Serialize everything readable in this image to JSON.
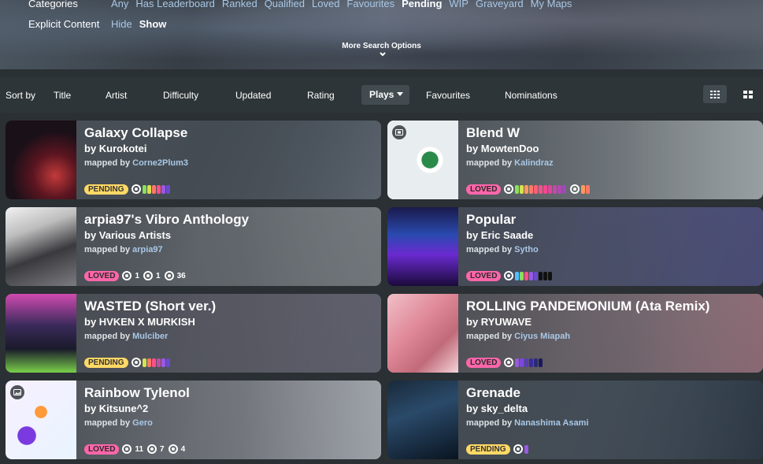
{
  "filters": {
    "categories_label": "Categories",
    "categories": [
      "Any",
      "Has Leaderboard",
      "Ranked",
      "Qualified",
      "Loved",
      "Favourites",
      "Pending",
      "WIP",
      "Graveyard",
      "My Maps"
    ],
    "categories_active": "Pending",
    "explicit_label": "Explicit Content",
    "explicit_options": [
      "Hide",
      "Show"
    ],
    "explicit_active": "Show",
    "more_options": "More Search Options"
  },
  "sort": {
    "label": "Sort by",
    "items": [
      "Title",
      "Artist",
      "Difficulty",
      "Updated",
      "Rating",
      "Plays",
      "Favourites",
      "Nominations"
    ],
    "active": "Plays"
  },
  "colors": {
    "pending": "#ffd966",
    "loved": "#ff66aa",
    "link": "#a9c8e6"
  },
  "cards": [
    {
      "title": "Galaxy Collapse",
      "artist": "by Kurokotei",
      "mapped_by": "mapped by",
      "mapper": "Corne2Plum3",
      "status": "PENDING",
      "stats": []
    },
    {
      "title": "Blend W",
      "artist": "by MowtenDoo",
      "mapped_by": "mapped by",
      "mapper": "Kalindraz",
      "status": "LOVED",
      "stats": []
    },
    {
      "title": "arpia97's Vibro Anthology",
      "artist": "by Various Artists",
      "mapped_by": "mapped by",
      "mapper": "arpia97",
      "status": "LOVED",
      "stats": [
        "1",
        "1",
        "36"
      ]
    },
    {
      "title": "Popular",
      "artist": "by Eric Saade",
      "mapped_by": "mapped by",
      "mapper": "Sytho",
      "status": "LOVED",
      "stats": []
    },
    {
      "title": "WASTED (Short ver.)",
      "artist": "by HVKEN X MURKISH",
      "mapped_by": "mapped by",
      "mapper": "Mulciber",
      "status": "PENDING",
      "stats": []
    },
    {
      "title": "ROLLING PANDEMONIUM (Ata Remix)",
      "artist": "by RYUWAVE",
      "mapped_by": "mapped by",
      "mapper": "Ciyus Miapah",
      "status": "LOVED",
      "stats": []
    },
    {
      "title": "Rainbow Tylenol",
      "artist": "by Kitsune^2",
      "mapped_by": "mapped by",
      "mapper": "Gero",
      "status": "LOVED",
      "stats": [
        "11",
        "7",
        "4"
      ]
    },
    {
      "title": "Grenade",
      "artist": "by sky_delta",
      "mapped_by": "mapped by",
      "mapper": "Nanashima Asami",
      "status": "PENDING",
      "stats": []
    }
  ]
}
